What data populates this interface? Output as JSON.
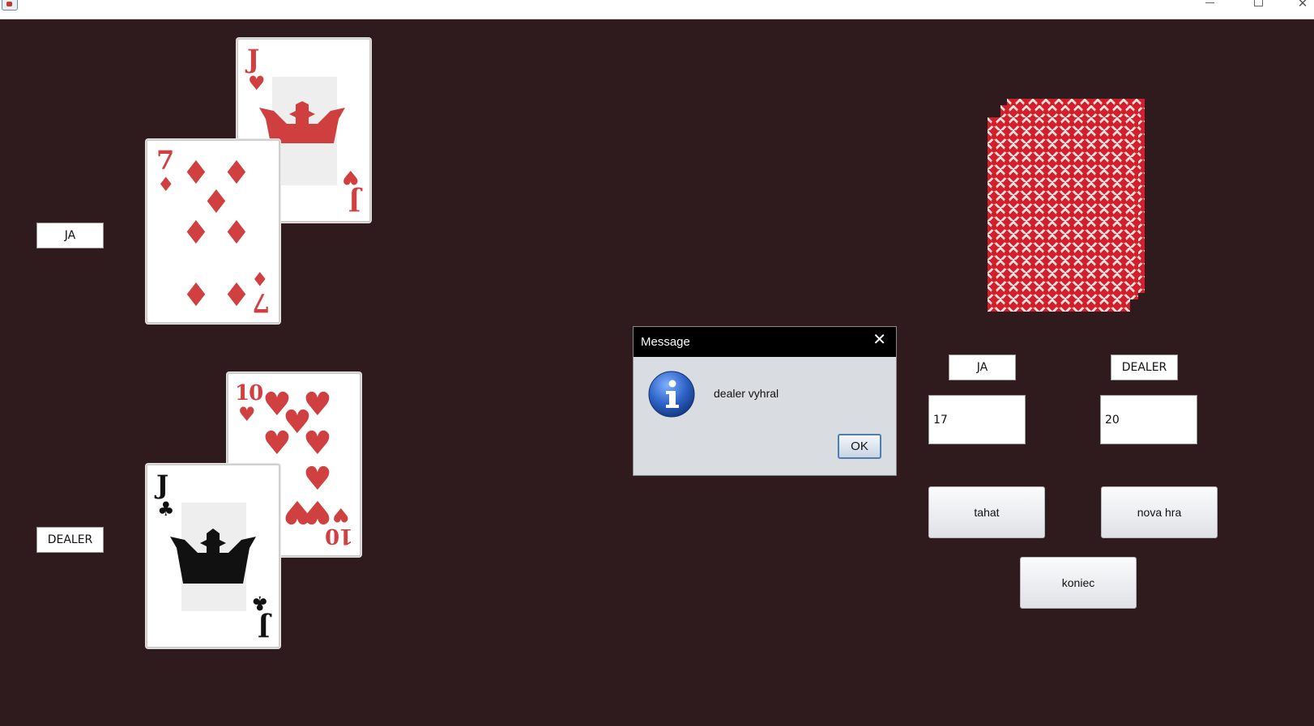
{
  "window": {
    "minimize_icon": "minimize-icon",
    "maximize_icon": "maximize-icon",
    "close_glyph": "✕"
  },
  "table": {
    "player_label": "JA",
    "dealer_label": "DEALER",
    "background_color": "#2f1b1e"
  },
  "player_cards": [
    {
      "rank": "J",
      "suit": "♥",
      "color": "red"
    },
    {
      "rank": "7",
      "suit": "♦",
      "color": "red"
    }
  ],
  "dealer_cards": [
    {
      "rank": "10",
      "suit": "♥",
      "color": "red"
    },
    {
      "rank": "J",
      "suit": "♣",
      "color": "black"
    }
  ],
  "scoreboard": {
    "player_header": "JA",
    "dealer_header": "DEALER",
    "player_score": "17",
    "dealer_score": "20"
  },
  "buttons": {
    "hit": "tahat",
    "new_game": "nova hra",
    "quit": "koniec"
  },
  "dialog": {
    "title": "Message",
    "message": "dealer vyhral",
    "ok": "OK",
    "close_glyph": "✕",
    "icon": "info-icon"
  }
}
